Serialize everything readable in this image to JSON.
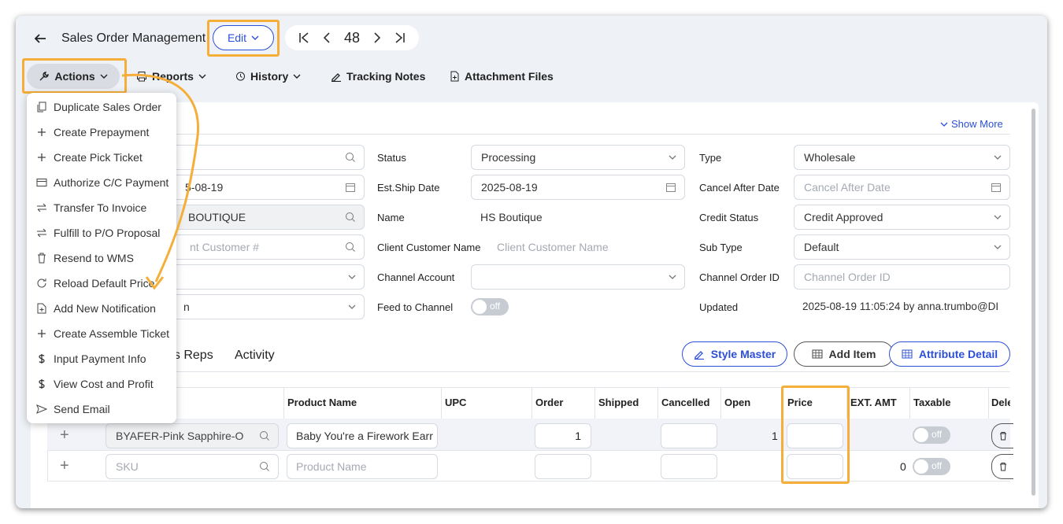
{
  "header": {
    "title": "Sales Order Management",
    "edit_label": "Edit",
    "record_number": "48"
  },
  "toolbar": {
    "actions": "Actions",
    "reports": "Reports",
    "history": "History",
    "tracking_notes": "Tracking Notes",
    "attachment_files": "Attachment Files"
  },
  "actions_menu": [
    {
      "label": "Duplicate Sales Order",
      "icon": "copy-icon"
    },
    {
      "label": "Create Prepayment",
      "icon": "plus-icon"
    },
    {
      "label": "Create Pick Ticket",
      "icon": "plus-icon"
    },
    {
      "label": "Authorize C/C Payment",
      "icon": "card-icon"
    },
    {
      "label": "Transfer To Invoice",
      "icon": "transfer-icon"
    },
    {
      "label": "Fulfill to P/O Proposal",
      "icon": "transfer-icon"
    },
    {
      "label": "Resend to WMS",
      "icon": "trash-icon"
    },
    {
      "label": "Reload Default Price",
      "icon": "reload-icon"
    },
    {
      "label": "Add New Notification",
      "icon": "add-file-icon"
    },
    {
      "label": "Create Assemble Ticket",
      "icon": "plus-icon"
    },
    {
      "label": "Input Payment Info",
      "icon": "dollar-icon"
    },
    {
      "label": "View Cost and Profit",
      "icon": "dollar-icon"
    },
    {
      "label": "Send Email",
      "icon": "send-icon"
    }
  ],
  "form": {
    "show_more": "Show More",
    "left_col": {
      "date_partial": "5-08-19",
      "customer_partial": "BOUTIQUE",
      "client_customer_partial": "nt Customer #",
      "select_partial": "n"
    },
    "status_label": "Status",
    "status_value": "Processing",
    "est_ship_label": "Est.Ship Date",
    "est_ship_value": "2025-08-19",
    "name_label": "Name",
    "name_value": "HS Boutique",
    "client_customer_name_label": "Client Customer Name",
    "client_customer_name_placeholder": "Client Customer Name",
    "channel_account_label": "Channel Account",
    "feed_to_channel_label": "Feed to Channel",
    "feed_toggle": "off",
    "type_label": "Type",
    "type_value": "Wholesale",
    "cancel_after_label": "Cancel After Date",
    "cancel_after_placeholder": "Cancel After Date",
    "credit_status_label": "Credit Status",
    "credit_status_value": "Credit Approved",
    "sub_type_label": "Sub Type",
    "sub_type_value": "Default",
    "channel_order_label": "Channel Order ID",
    "channel_order_placeholder": "Channel Order ID",
    "updated_label": "Updated",
    "updated_value": "2025-08-19 11:05:24 by anna.trumbo@DI"
  },
  "tabs": {
    "sales_reps_partial": "es Reps",
    "activity": "Activity"
  },
  "item_buttons": {
    "style_master": "Style Master",
    "add_item": "Add Item",
    "attribute_detail": "Attribute Detail"
  },
  "table": {
    "headers": [
      "Product Name",
      "UPC",
      "Order",
      "Shipped",
      "Cancelled",
      "Open",
      "Price",
      "EXT. AMT",
      "Taxable",
      "Dele"
    ],
    "rows": [
      {
        "sku": "BYAFER-Pink Sapphire-O",
        "product": "Baby You're a Firework Earr",
        "order": "1",
        "open": "1",
        "taxable": "off",
        "ext": ""
      },
      {
        "sku": "SKU",
        "product": "Product Name",
        "order": "",
        "open": "",
        "taxable": "off",
        "ext": "0"
      }
    ]
  }
}
